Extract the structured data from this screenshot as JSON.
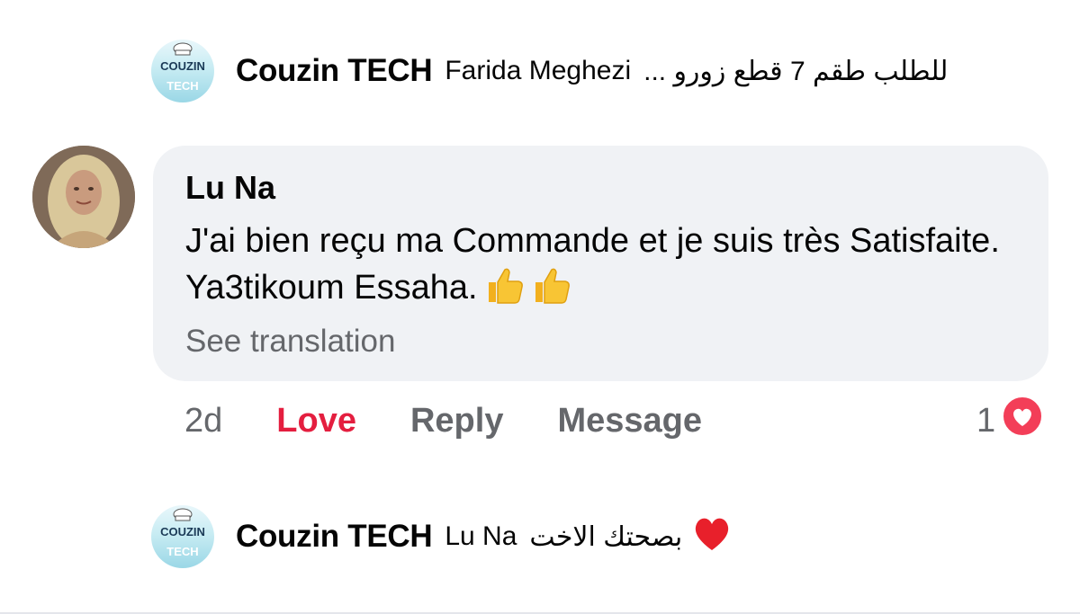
{
  "top_reply": {
    "author": "Couzin TECH",
    "mention": "Farida Meghezi",
    "text_rtl": "للطلب طقم 7 قطع  زورو ...",
    "logo_top": "COUZIN",
    "logo_bottom": "TECH"
  },
  "comment": {
    "author": "Lu Na",
    "text": "J'ai bien reçu ma Commande et je suis  très Satisfaite.  Ya3tikoum Essaha.",
    "emoji": [
      "thumbs-up",
      "thumbs-up"
    ],
    "see_translation": "See translation"
  },
  "actions": {
    "time": "2d",
    "love": "Love",
    "reply": "Reply",
    "message": "Message",
    "reaction_count": "1",
    "reaction_icon": "heart-icon"
  },
  "bottom_reply": {
    "author": "Couzin TECH",
    "mention": "Lu Na",
    "text_rtl": "بصحتك الاخت",
    "emoji": "red-heart",
    "logo_top": "COUZIN",
    "logo_bottom": "TECH"
  },
  "colors": {
    "love_red": "#e41e3f",
    "muted_gray": "#65676b",
    "bubble_bg": "#f0f2f5"
  }
}
